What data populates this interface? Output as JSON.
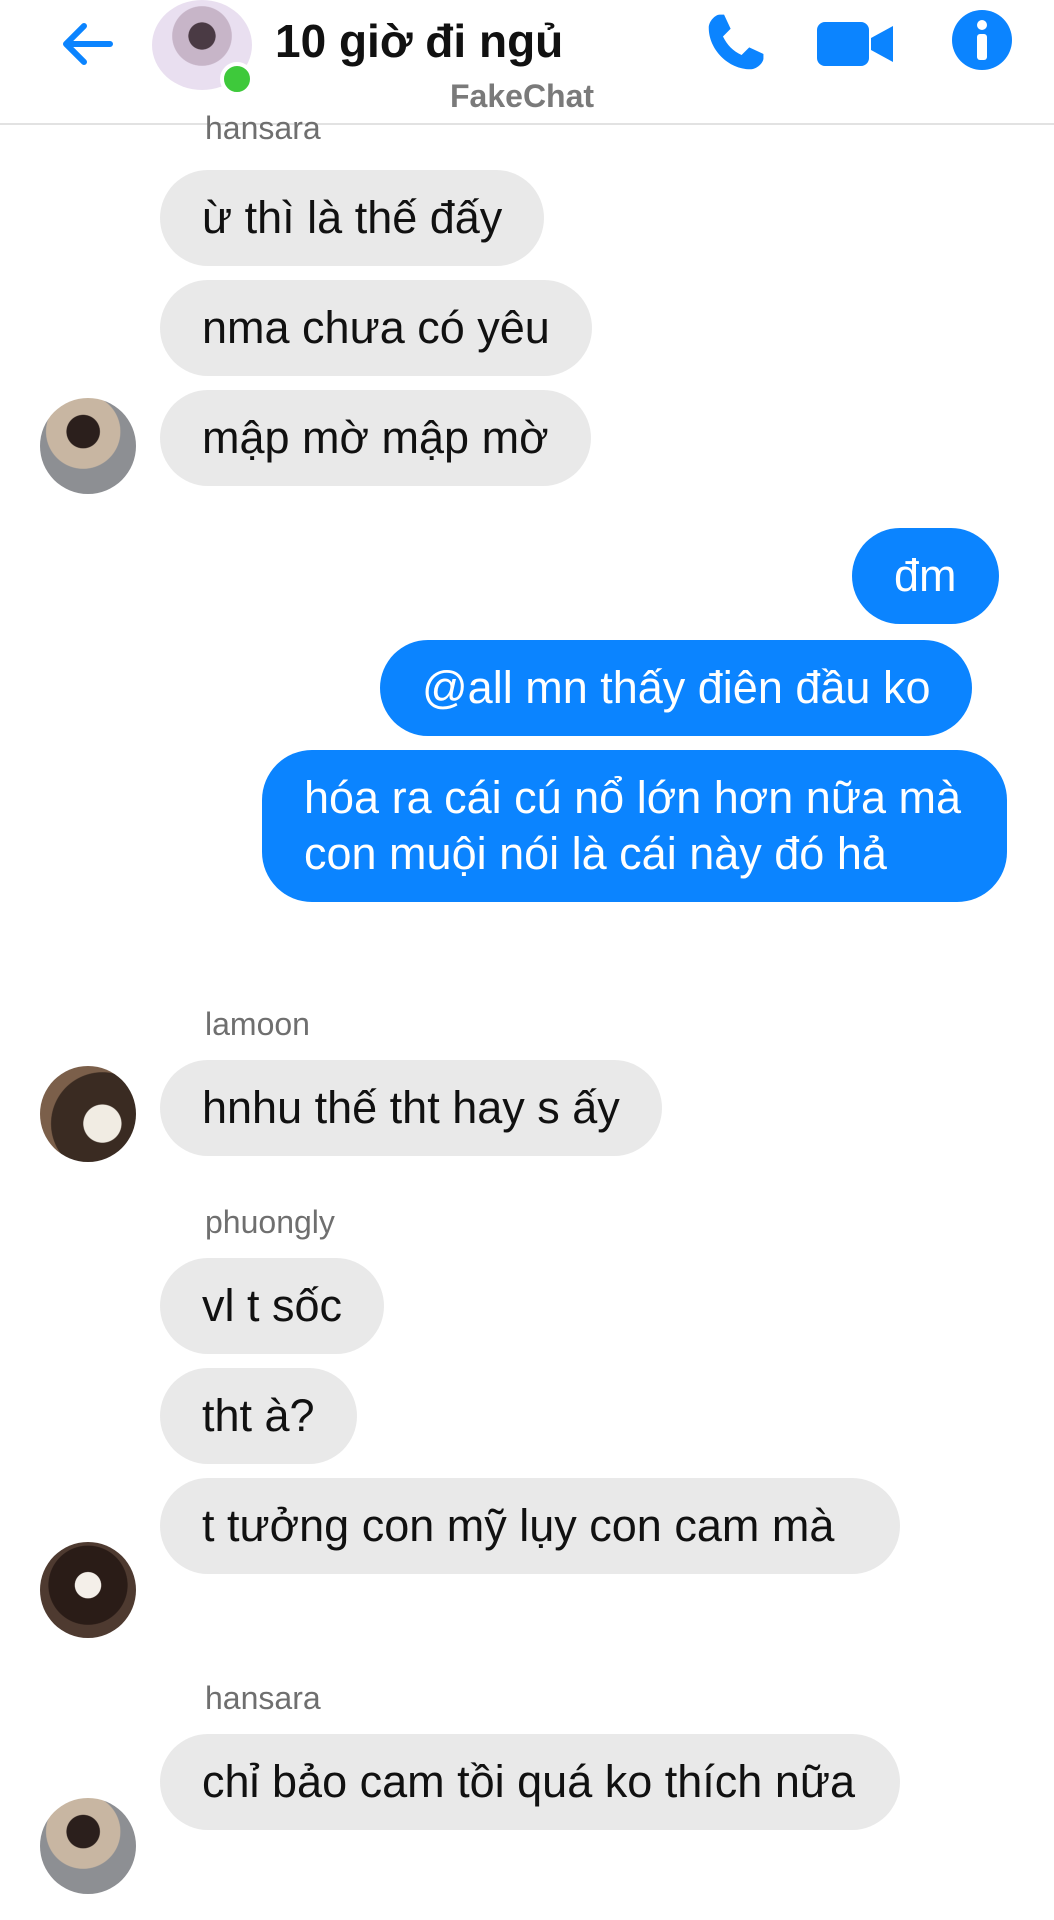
{
  "header": {
    "back_icon": "back-arrow-icon",
    "title": "10 giờ đi ngủ",
    "subtitle": "FakeChat",
    "call_icon": "phone-icon",
    "video_icon": "video-camera-icon",
    "info_icon": "info-icon",
    "accent_color": "#0b84ff"
  },
  "messages": [
    {
      "sender": "hansara",
      "texts": [
        "ừ thì là thế đấy",
        "nma chưa có yêu",
        "mập mờ mập mờ"
      ]
    },
    {
      "sender": "me",
      "texts": [
        "đm",
        "@all mn thấy điên đầu ko",
        "hóa ra cái cú nổ lớn hơn nữa mà con muội nói là cái này đó hả"
      ]
    },
    {
      "sender": "lamoon",
      "texts": [
        "hnhu thế tht hay s ấy"
      ]
    },
    {
      "sender": "phuongly",
      "texts": [
        "vl t sốc",
        "tht à?",
        "t tưởng con mỹ lụy con cam mà"
      ]
    },
    {
      "sender": "hansara",
      "texts": [
        "chỉ bảo cam tồi quá ko thích nữa"
      ]
    }
  ]
}
